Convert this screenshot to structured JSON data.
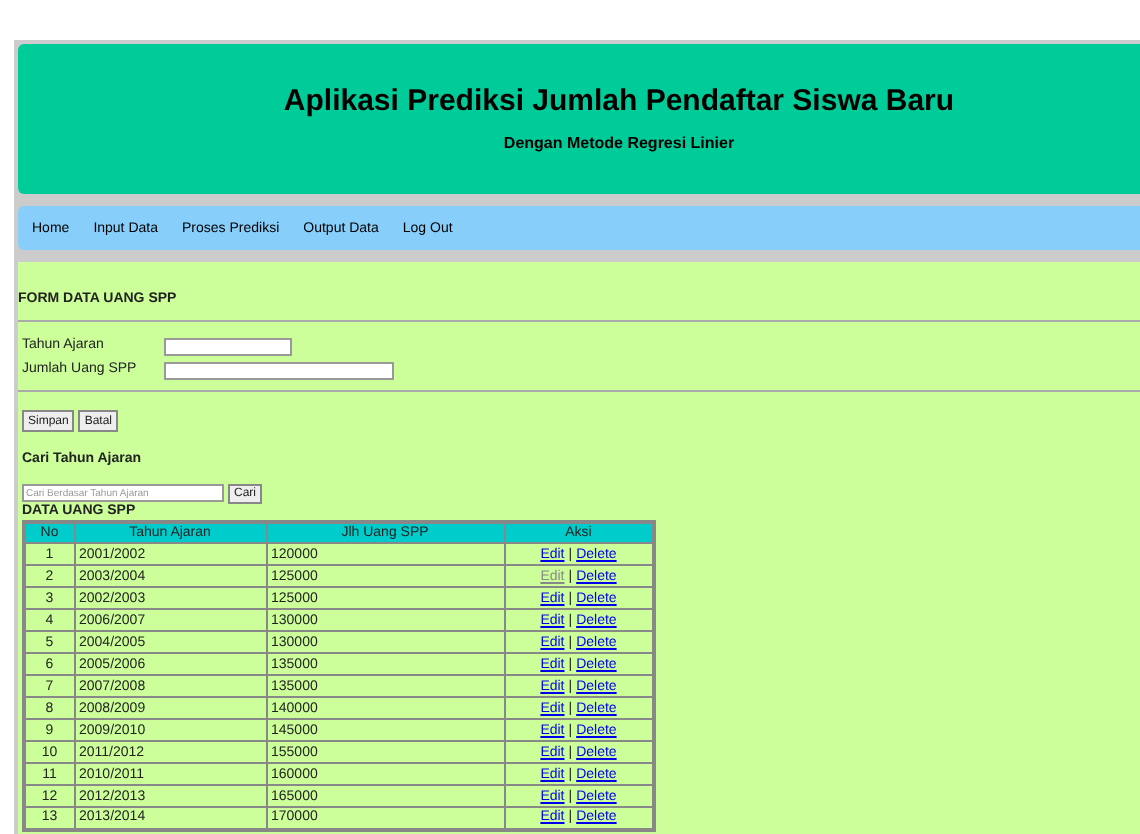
{
  "header": {
    "title": "Aplikasi Prediksi Jumlah Pendaftar Siswa Baru",
    "subtitle": "Dengan Metode Regresi Linier"
  },
  "nav": [
    "Home",
    "Input Data",
    "Proses Prediksi",
    "Output Data",
    "Log Out"
  ],
  "form": {
    "title": "FORM DATA UANG SPP",
    "fields": [
      {
        "label": "Tahun Ajaran"
      },
      {
        "label": "Jumlah Uang SPP"
      }
    ],
    "buttons": [
      "Simpan",
      "Batal"
    ]
  },
  "search": {
    "title": "Cari Tahun Ajaran",
    "placeholder": "Cari Berdasar Tahun Ajaran",
    "button": "Cari"
  },
  "table": {
    "title": "DATA UANG SPP",
    "columns": [
      "No",
      "Tahun Ajaran",
      "Jlh Uang SPP",
      "Aksi"
    ],
    "separator": "|",
    "rows": [
      {
        "no": "1",
        "tahun": "2001/2002",
        "jumlah": "120000",
        "edit": "Edit",
        "delete": "Delete",
        "edit_visited": false
      },
      {
        "no": "2",
        "tahun": "2003/2004",
        "jumlah": "125000",
        "edit": "Edit",
        "delete": "Delete",
        "edit_visited": true
      },
      {
        "no": "3",
        "tahun": "2002/2003",
        "jumlah": "125000",
        "edit": "Edit",
        "delete": "Delete",
        "edit_visited": false
      },
      {
        "no": "4",
        "tahun": "2006/2007",
        "jumlah": "130000",
        "edit": "Edit",
        "delete": "Delete",
        "edit_visited": false
      },
      {
        "no": "5",
        "tahun": "2004/2005",
        "jumlah": "130000",
        "edit": "Edit",
        "delete": "Delete",
        "edit_visited": false
      },
      {
        "no": "6",
        "tahun": "2005/2006",
        "jumlah": "135000",
        "edit": "Edit",
        "delete": "Delete",
        "edit_visited": false
      },
      {
        "no": "7",
        "tahun": "2007/2008",
        "jumlah": "135000",
        "edit": "Edit",
        "delete": "Delete",
        "edit_visited": false
      },
      {
        "no": "8",
        "tahun": "2008/2009",
        "jumlah": "140000",
        "edit": "Edit",
        "delete": "Delete",
        "edit_visited": false
      },
      {
        "no": "9",
        "tahun": "2009/2010",
        "jumlah": "145000",
        "edit": "Edit",
        "delete": "Delete",
        "edit_visited": false
      },
      {
        "no": "10",
        "tahun": "2011/2012",
        "jumlah": "155000",
        "edit": "Edit",
        "delete": "Delete",
        "edit_visited": false
      },
      {
        "no": "11",
        "tahun": "2010/2011",
        "jumlah": "160000",
        "edit": "Edit",
        "delete": "Delete",
        "edit_visited": false
      },
      {
        "no": "12",
        "tahun": "2012/2013",
        "jumlah": "165000",
        "edit": "Edit",
        "delete": "Delete",
        "edit_visited": false
      },
      {
        "no": "13",
        "tahun": "2013/2014",
        "jumlah": "170000",
        "edit": "Edit",
        "delete": "Delete",
        "edit_visited": false
      }
    ]
  }
}
